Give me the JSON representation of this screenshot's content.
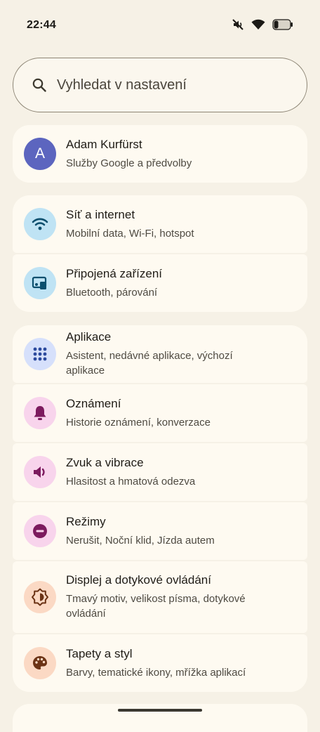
{
  "status_bar": {
    "time": "22:44",
    "icons": [
      "mute-vibrate-icon",
      "wifi-icon",
      "battery-icon"
    ]
  },
  "search": {
    "placeholder": "Vyhledat v nastavení"
  },
  "account": {
    "avatar_letter": "A",
    "name": "Adam Kurfürst",
    "subtitle": "Služby Google a předvolby"
  },
  "connectivity": [
    {
      "title": "Síť a internet",
      "subtitle": "Mobilní data, Wi-Fi, hotspot",
      "icon": "wifi-icon"
    },
    {
      "title": "Připojená zařízení",
      "subtitle": "Bluetooth, párování",
      "icon": "connected-devices-icon"
    }
  ],
  "settings": [
    {
      "title": "Aplikace",
      "subtitle": "Asistent, nedávné aplikace, výchozí aplikace",
      "icon": "apps-grid-icon"
    },
    {
      "title": "Oznámení",
      "subtitle": "Historie oznámení, konverzace",
      "icon": "bell-icon"
    },
    {
      "title": "Zvuk a vibrace",
      "subtitle": "Hlasitost a hmatová odezva",
      "icon": "speaker-icon"
    },
    {
      "title": "Režimy",
      "subtitle": "Nerušit, Noční klid, Jízda autem",
      "icon": "do-not-disturb-icon"
    },
    {
      "title": "Displej a dotykové ovládání",
      "subtitle": "Tmavý motiv, velikost písma, dotykové ovládání",
      "icon": "brightness-icon"
    },
    {
      "title": "Tapety a styl",
      "subtitle": "Barvy, tematické ikony, mřížka aplikací",
      "icon": "palette-icon"
    }
  ],
  "colors": {
    "background": "#f6f1e6",
    "card": "#fefaf1",
    "avatar": "#5c65bf",
    "blue_icon_bg": "#bfe3f4",
    "blue_icon_fg": "#0b4f6e",
    "lavender_icon_bg": "#d6e0fb",
    "lavender_icon_fg": "#2c4a9e",
    "pink_icon_bg": "#f8d4ec",
    "pink_icon_fg": "#7c1a5e",
    "orange_icon_bg": "#fbd9c4",
    "orange_icon_fg": "#6b3315"
  }
}
